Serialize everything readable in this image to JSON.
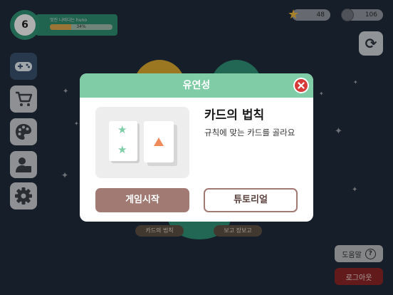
{
  "profile": {
    "level": "6",
    "name": "멋진 나비다는 huno",
    "xp_percent_label": "34%",
    "xp_fraction": 0.34
  },
  "currency": {
    "stars": "48",
    "coins": "106"
  },
  "sidebar": {
    "items": [
      {
        "name": "games",
        "icon": "gamepad-icon"
      },
      {
        "name": "shop",
        "icon": "cart-icon"
      },
      {
        "name": "customize",
        "icon": "palette-icon"
      },
      {
        "name": "profile",
        "icon": "user-icon"
      },
      {
        "name": "settings",
        "icon": "gear-icon"
      }
    ]
  },
  "background": {
    "label_left": "카드의 법칙",
    "label_right": "보고 장보고"
  },
  "help": {
    "label": "도움말",
    "icon": "question-icon"
  },
  "logout": {
    "label": "로그아웃"
  },
  "modal": {
    "title": "유연성",
    "game_title": "카드의 법칙",
    "description": "규칙에 맞는 카드를 골라요",
    "start_label": "게임시작",
    "tutorial_label": "튜토리얼"
  },
  "colors": {
    "background": "#1f2a3a",
    "modal_header": "#7fcca7",
    "start_button": "#a27a74",
    "close_button": "#d83a3a",
    "logout": "#8a2424"
  }
}
